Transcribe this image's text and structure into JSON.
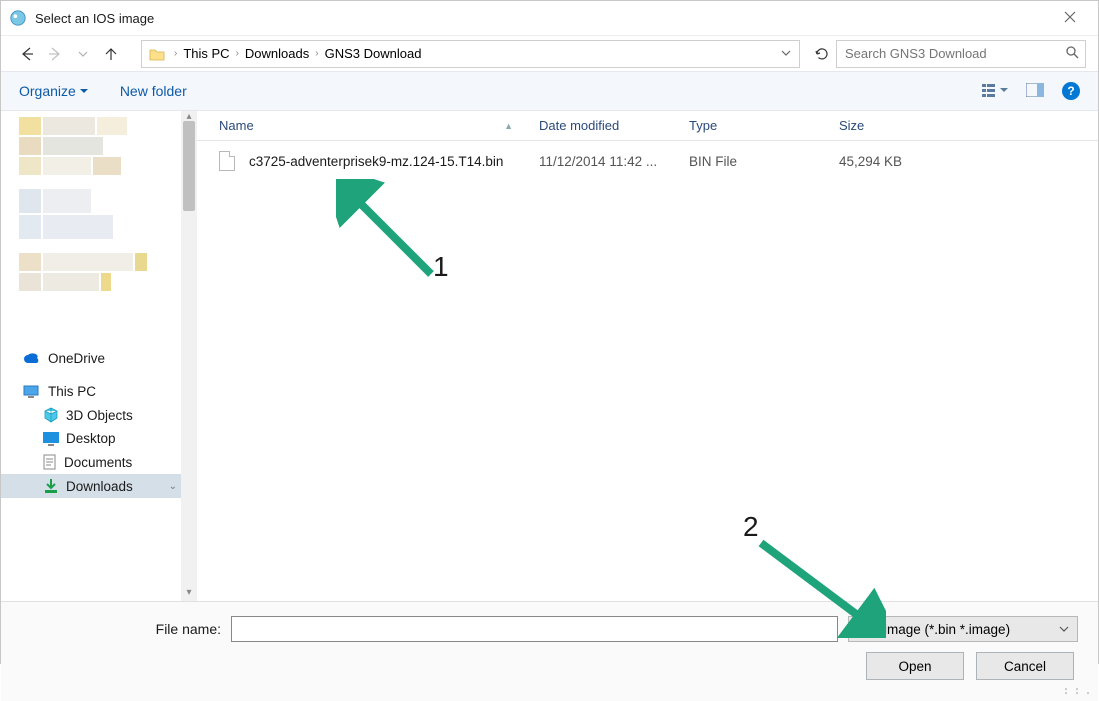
{
  "window": {
    "title": "Select an IOS image"
  },
  "breadcrumb": {
    "root": "This PC",
    "mid": "Downloads",
    "leaf": "GNS3 Download"
  },
  "search": {
    "placeholder": "Search GNS3 Download"
  },
  "toolbar": {
    "organize": "Organize",
    "newfolder": "New folder"
  },
  "sidebar": {
    "onedrive": "OneDrive",
    "thispc": "This PC",
    "items": {
      "objects3d": "3D Objects",
      "desktop": "Desktop",
      "documents": "Documents",
      "downloads": "Downloads"
    }
  },
  "columns": {
    "name": "Name",
    "date": "Date modified",
    "type": "Type",
    "size": "Size"
  },
  "files": [
    {
      "name": "c3725-adventerprisek9-mz.124-15.T14.bin",
      "date": "11/12/2014 11:42 ...",
      "type": "BIN File",
      "size": "45,294 KB"
    }
  ],
  "bottom": {
    "filename_label": "File name:",
    "filter": "IOS image (*.bin *.image)",
    "open": "Open",
    "cancel": "Cancel"
  },
  "annotations": {
    "one": "1",
    "two": "2"
  }
}
